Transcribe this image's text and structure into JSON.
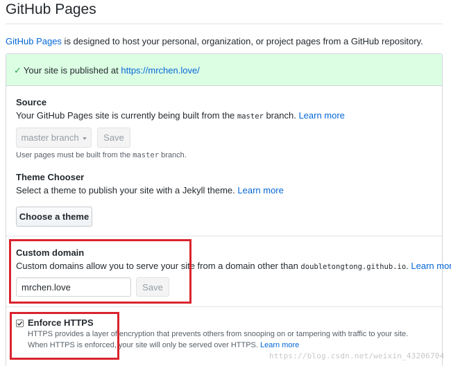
{
  "page": {
    "title": "GitHub Pages",
    "intro_link": "GitHub Pages",
    "intro_text": " is designed to host your personal, organization, or project pages from a GitHub repository."
  },
  "flash": {
    "text": "Your site is published at ",
    "url": "https://mrchen.love/"
  },
  "source": {
    "title": "Source",
    "desc_prefix": "Your GitHub Pages site is currently being built from the ",
    "branch_code": "master",
    "desc_suffix": " branch. ",
    "learn_more": "Learn more",
    "dropdown_label": "master branch",
    "save_label": "Save",
    "note_prefix": "User pages must be built from the ",
    "note_code": "master",
    "note_suffix": " branch."
  },
  "theme": {
    "title": "Theme Chooser",
    "desc": "Select a theme to publish your site with a Jekyll theme. ",
    "learn_more": "Learn more",
    "button_label": "Choose a theme"
  },
  "custom_domain": {
    "title": "Custom domain",
    "desc": "Custom domains allow you to serve your site from a domain other than ",
    "domain_code": "doubletongtong.github.io",
    "desc_suffix": ". ",
    "learn_more": "Learn more",
    "input_value": "mrchen.love",
    "save_label": "Save"
  },
  "https": {
    "checked": true,
    "title": "Enforce HTTPS",
    "line1": "HTTPS provides a layer of encryption that prevents others from snooping on or tampering with traffic to your site.",
    "line2": "When HTTPS is enforced, your site will only be served over HTTPS. ",
    "learn_more": "Learn more"
  },
  "watermark": "https://blog.csdn.net/weixin_43206704",
  "colors": {
    "link": "#0366d6",
    "success_bg": "#dcffe4",
    "check_green": "#28a745",
    "highlight_red": "#d9232e"
  },
  "icons": {
    "flash_check": "check-icon",
    "dropdown": "caret-down-icon",
    "checkbox": "checkbox-checked-icon"
  }
}
